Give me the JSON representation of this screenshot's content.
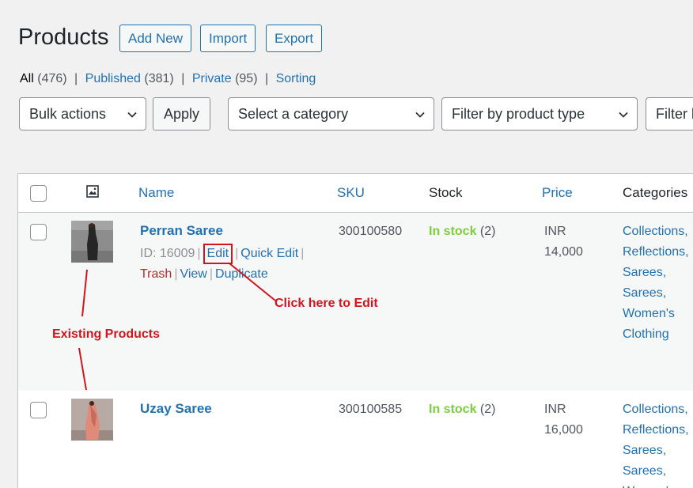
{
  "header": {
    "title": "Products",
    "add_new": "Add New",
    "import": "Import",
    "export": "Export"
  },
  "status_filter": {
    "all_label": "All",
    "all_count": "(476)",
    "published_label": "Published",
    "published_count": "(381)",
    "private_label": "Private",
    "private_count": "(95)",
    "sorting_label": "Sorting",
    "separator": "|"
  },
  "filters": {
    "bulk_actions": "Bulk actions",
    "apply": "Apply",
    "category": "Select a category",
    "product_type": "Filter by product type",
    "stock_status": "Filter b"
  },
  "table": {
    "columns": {
      "name": "Name",
      "sku": "SKU",
      "stock": "Stock",
      "price": "Price",
      "categories": "Categories"
    },
    "rows": [
      {
        "name": "Perran Saree",
        "id_text": "ID: 16009",
        "actions": {
          "edit": "Edit",
          "quick_edit": "Quick Edit",
          "trash": "Trash",
          "view": "View",
          "duplicate": "Duplicate"
        },
        "sku": "300100580",
        "stock_status": "In stock",
        "stock_qty": "(2)",
        "price_currency": "INR",
        "price_value": "14,000",
        "categories": [
          "Collections,",
          "Reflections,",
          "Sarees,",
          "Sarees,",
          "Women's",
          "Clothing"
        ]
      },
      {
        "name": "Uzay Saree",
        "sku": "300100585",
        "stock_status": "In stock",
        "stock_qty": "(2)",
        "price_currency": "INR",
        "price_value": "16,000",
        "categories": [
          "Collections,",
          "Reflections,",
          "Sarees,",
          "Sarees,",
          "Women's"
        ]
      }
    ]
  },
  "annotations": {
    "edit_hint": "Click here to Edit",
    "existing_products": "Existing Products"
  },
  "colors": {
    "accent": "#2271b1",
    "in_stock": "#7ad03a",
    "trash": "#b32d2e",
    "annotation": "#d0151d"
  }
}
